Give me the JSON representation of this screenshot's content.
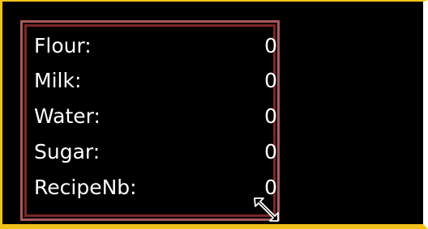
{
  "panel": {
    "rows": [
      {
        "label": "Flour:",
        "value": "0"
      },
      {
        "label": "Milk:",
        "value": "0"
      },
      {
        "label": "Water:",
        "value": "0"
      },
      {
        "label": "Sugar:",
        "value": "0"
      },
      {
        "label": "RecipeNb:",
        "value": "0"
      }
    ]
  },
  "colors": {
    "frame": "#f2c21a",
    "background": "#000000",
    "panel_border_outer": "#a85a5a",
    "panel_border_inner": "#7a2626",
    "text": "#ffffff"
  },
  "cursor": {
    "icon": "resize-diagonal-icon"
  }
}
